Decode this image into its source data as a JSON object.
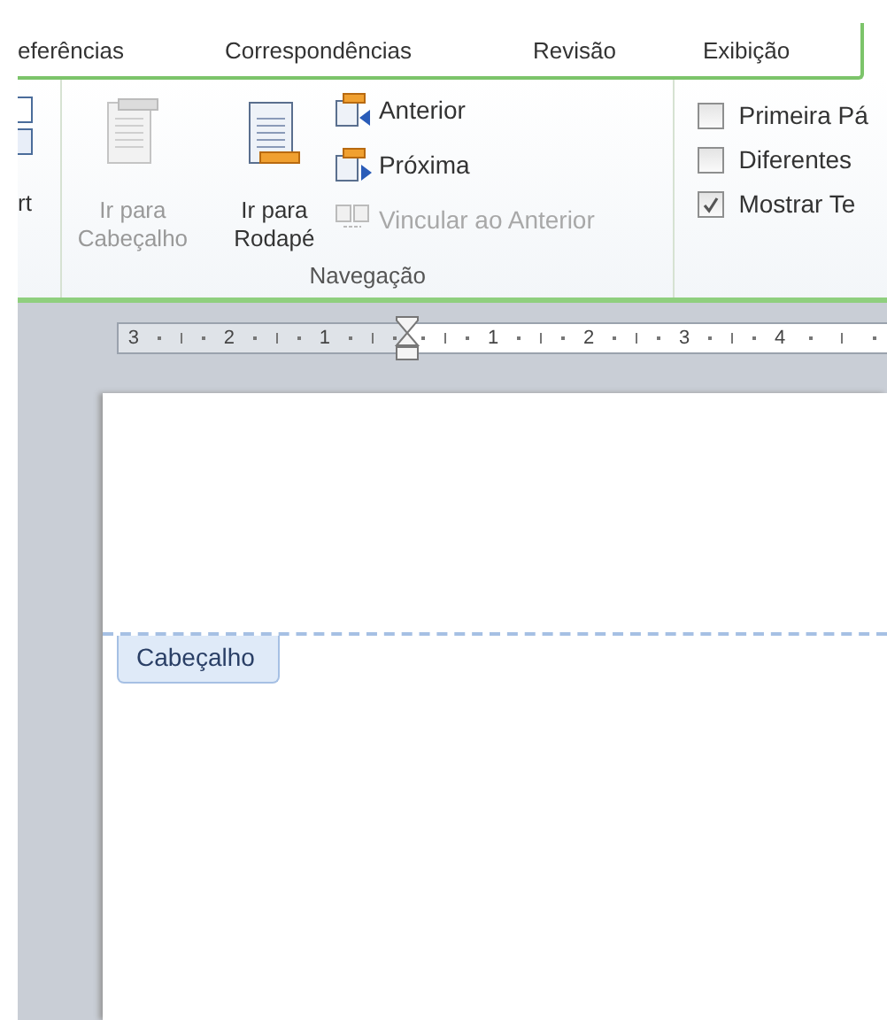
{
  "tabs": [
    {
      "label": "eferências",
      "selected": false
    },
    {
      "label": "Correspondências",
      "selected": false
    },
    {
      "label": "Revisão",
      "selected": false
    },
    {
      "label": "Exibição",
      "selected": false
    }
  ],
  "ribbon": {
    "partial_group": {
      "label": "rt"
    },
    "navigation": {
      "label": "Navegação",
      "large_buttons": [
        {
          "label": "Ir para Cabeçalho",
          "disabled": true
        },
        {
          "label": "Ir para Rodapé",
          "disabled": false
        }
      ],
      "small_buttons": [
        {
          "label": "Anterior",
          "kind": "previous",
          "disabled": false
        },
        {
          "label": "Próxima",
          "kind": "next",
          "disabled": false
        },
        {
          "label": "Vincular ao Anterior",
          "kind": "link",
          "disabled": true
        }
      ]
    },
    "options": [
      {
        "label": "Primeira Pá",
        "checked": false
      },
      {
        "label": "Diferentes",
        "checked": false
      },
      {
        "label": "Mostrar Te",
        "checked": true
      }
    ]
  },
  "ruler": {
    "left_numbers": [
      "3",
      "2",
      "1"
    ],
    "right_numbers": [
      "1",
      "2",
      "3",
      "4"
    ]
  },
  "page": {
    "header_tag": "Cabeçalho"
  }
}
